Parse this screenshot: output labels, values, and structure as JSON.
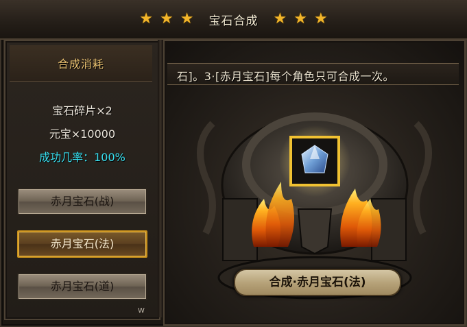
{
  "window": {
    "title": "宝石合成",
    "stars_left": [
      "★",
      "★",
      "★"
    ],
    "stars_right": [
      "★",
      "★",
      "★"
    ]
  },
  "left": {
    "header": "合成消耗",
    "costs": {
      "shards": "宝石碎片×2",
      "gold": "元宝×10000",
      "success_rate": "成功几率：100%"
    },
    "options": [
      {
        "label": "赤月宝石(战)",
        "selected": false
      },
      {
        "label": "赤月宝石(法)",
        "selected": true
      },
      {
        "label": "赤月宝石(道)",
        "selected": false
      }
    ],
    "corner_mark": "W"
  },
  "right": {
    "banner_text": "石]。3·[赤月宝石]每个角色只可合成一次。",
    "result_label": "合成·赤月宝石(法)",
    "gem_icon": "blue-gem-icon",
    "colors": {
      "gold_frame": "#f1c232",
      "flame": "#f07a10",
      "success": "#38e0f0"
    }
  }
}
